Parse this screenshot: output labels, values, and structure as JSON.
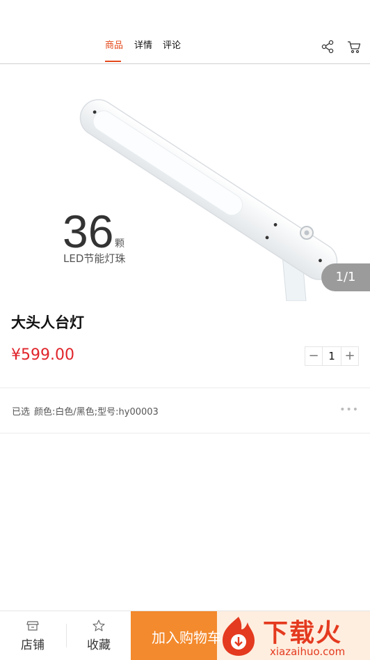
{
  "header": {
    "tabs": [
      {
        "label": "商品",
        "active": true
      },
      {
        "label": "详情",
        "active": false
      },
      {
        "label": "评论",
        "active": false
      }
    ],
    "icons": [
      "share-icon",
      "cart-icon"
    ],
    "accent_color": "#e4491c"
  },
  "gallery": {
    "image_text_number": "36",
    "image_text_unit": "颗",
    "image_text_caption": "LED节能灯珠",
    "counter": "1/1"
  },
  "product": {
    "title": "大头人台灯",
    "price": "¥599.00",
    "price_color": "#e0252b",
    "quantity": "1",
    "minus_label": "−",
    "plus_label": "+"
  },
  "spec": {
    "label": "已选",
    "value": "颜色:白色/黑色;型号:hy00003",
    "more": "•••"
  },
  "bottom_bar": {
    "shop_label": "店铺",
    "favorite_label": "收藏",
    "add_to_cart_label": "加入购物车",
    "button_color": "#f38a2d"
  },
  "watermark": {
    "title": "下载火",
    "url": "xiazaihuo.com"
  }
}
